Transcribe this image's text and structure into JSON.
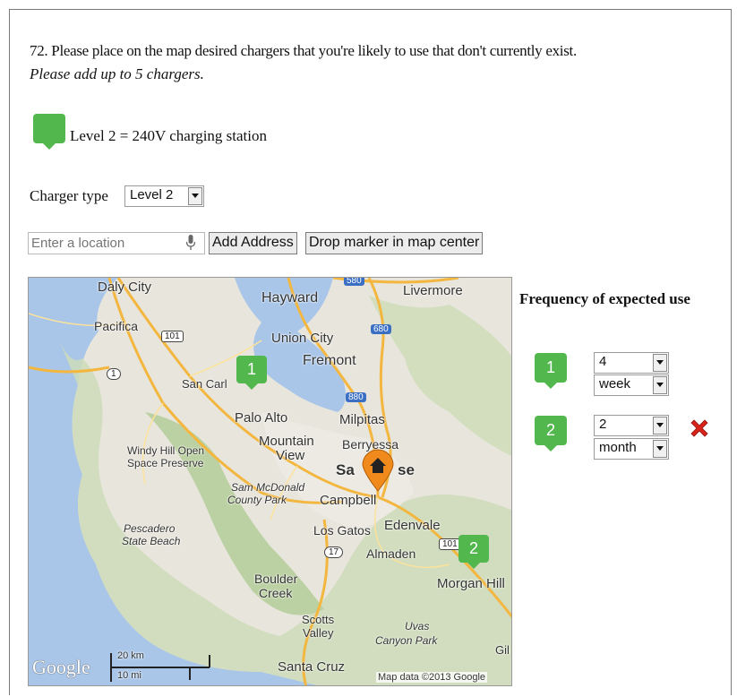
{
  "question": {
    "text": "72. Please place on the map desired chargers that you're likely to use that don't currently exist.",
    "instruction": "Please add up to 5 chargers."
  },
  "legend": {
    "label": "Level 2 = 240V charging station",
    "color": "#52b84e"
  },
  "charger_type": {
    "label": "Charger type",
    "selected": "Level 2"
  },
  "location": {
    "placeholder": "Enter a location",
    "add_button": "Add Address",
    "drop_button": "Drop marker in map center"
  },
  "map": {
    "labels": {
      "daly_city": "Daly City",
      "hayward": "Hayward",
      "livermore": "Livermore",
      "pacifica": "Pacifica",
      "union_city": "Union City",
      "fremont": "Fremont",
      "san_carlos": "San Carl",
      "palo_alto": "Palo Alto",
      "milpitas": "Milpitas",
      "mountain_view_1": "Mountain",
      "mountain_view_2": "View",
      "berryessa": "Berryessa",
      "san_jose_1": "Sa",
      "san_jose_2": "se",
      "windy_hill_1": "Windy Hill Open",
      "windy_hill_2": "Space Preserve",
      "sam_mcdonald_1": "Sam McDonald",
      "sam_mcdonald_2": "County Park",
      "campbell": "Campbell",
      "pescadero_1": "Pescadero",
      "pescadero_2": "State Beach",
      "los_gatos": "Los Gatos",
      "edenvale": "Edenvale",
      "almaden": "Almaden",
      "boulder_creek_1": "Boulder",
      "boulder_creek_2": "Creek",
      "morgan_hill": "Morgan Hill",
      "scotts_valley_1": "Scotts",
      "scotts_valley_2": "Valley",
      "uvas_1": "Uvas",
      "uvas_2": "Canyon Park",
      "gilroy": "Gil",
      "santa_cruz": "Santa Cruz",
      "hwy_580": "580",
      "hwy_680": "680",
      "hwy_101a": "101",
      "hwy_1": "1",
      "hwy_880": "880",
      "hwy_17": "17",
      "hwy_101b": "101"
    },
    "google_logo": "Google",
    "scale_km": "20 km",
    "scale_mi": "10 mi",
    "attribution": "Map data ©2013 Google",
    "markers": [
      {
        "label": "1"
      },
      {
        "label": "2"
      }
    ],
    "home_icon": "home-marker-icon"
  },
  "frequency": {
    "title": "Frequency of expected use",
    "items": [
      {
        "label": "1",
        "count": "4",
        "period": "week"
      },
      {
        "label": "2",
        "count": "2",
        "period": "month"
      }
    ],
    "delete_icon": "delete-x-icon",
    "delete_color": "#d9241c"
  }
}
